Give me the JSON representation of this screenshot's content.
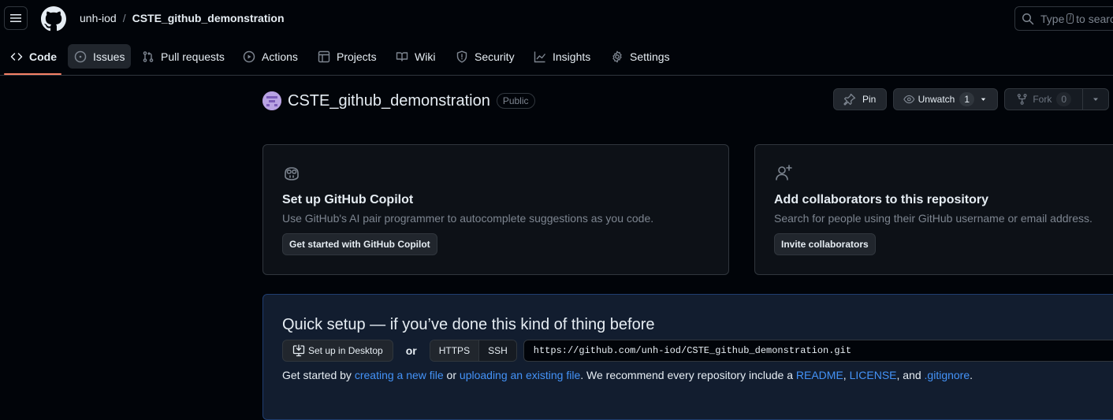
{
  "header": {
    "owner": "unh-iod",
    "separator": "/",
    "repo": "CSTE_github_demonstration",
    "search_prefix": "Type",
    "search_key": "/",
    "search_suffix": "to search"
  },
  "nav": {
    "tabs": [
      {
        "label": "Code",
        "icon": "code-icon"
      },
      {
        "label": "Issues",
        "icon": "issue-opened-icon"
      },
      {
        "label": "Pull requests",
        "icon": "git-pull-request-icon"
      },
      {
        "label": "Actions",
        "icon": "play-icon"
      },
      {
        "label": "Projects",
        "icon": "table-icon"
      },
      {
        "label": "Wiki",
        "icon": "book-icon"
      },
      {
        "label": "Security",
        "icon": "shield-icon"
      },
      {
        "label": "Insights",
        "icon": "graph-icon"
      },
      {
        "label": "Settings",
        "icon": "gear-icon"
      }
    ],
    "active": "Code"
  },
  "repo": {
    "name": "CSTE_github_demonstration",
    "visibility": "Public",
    "pin_label": "Pin",
    "watch_label": "Unwatch",
    "watch_count": "1",
    "fork_label": "Fork",
    "fork_count": "0"
  },
  "cards": {
    "copilot": {
      "title": "Set up GitHub Copilot",
      "desc": "Use GitHub's AI pair programmer to autocomplete suggestions as you code.",
      "button": "Get started with GitHub Copilot"
    },
    "collab": {
      "title": "Add collaborators to this repository",
      "desc": "Search for people using their GitHub username or email address.",
      "button": "Invite collaborators"
    }
  },
  "quick": {
    "title": "Quick setup — if you’ve done this kind of thing before",
    "desktop_button": "Set up in Desktop",
    "or": "or",
    "https": "HTTPS",
    "ssh": "SSH",
    "url": "https://github.com/unh-iod/CSTE_github_demonstration.git",
    "help": {
      "t1": "Get started by ",
      "l1": "creating a new file",
      "t2": " or ",
      "l2": "uploading an existing file",
      "t3": ". We recommend every repository include a ",
      "l3": "README",
      "t4": ", ",
      "l4": "LICENSE",
      "t5": ", and ",
      "l5": ".gitignore",
      "t6": "."
    }
  },
  "colors": {
    "background": "#010409",
    "accent_underline": "#f78166",
    "link": "#4493f8"
  }
}
